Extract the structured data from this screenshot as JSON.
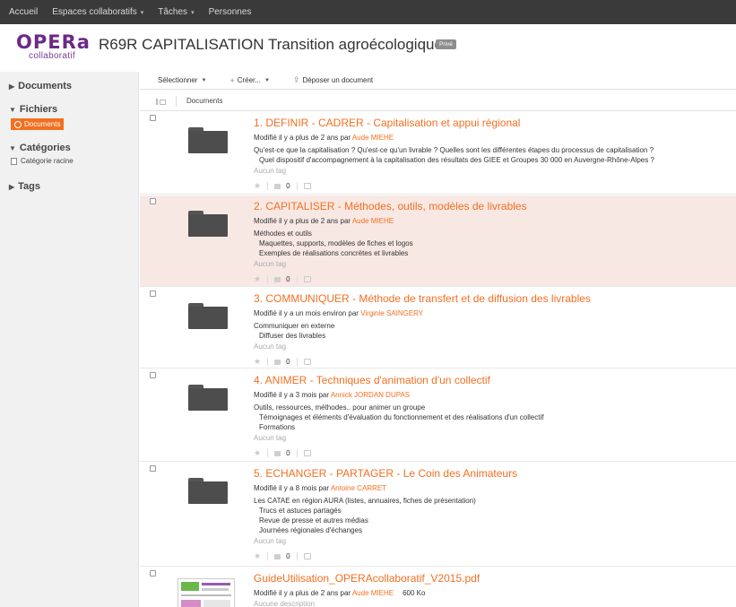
{
  "topnav": {
    "items": [
      {
        "label": "Accueil",
        "caret": ""
      },
      {
        "label": "Espaces collaboratifs",
        "caret": "▾"
      },
      {
        "label": "Tâches",
        "caret": "▾"
      },
      {
        "label": "Personnes",
        "caret": ""
      }
    ]
  },
  "header": {
    "logo_main": "OPERa",
    "logo_sub": "collaboratif",
    "title": "R69R CAPITALISATION Transition agroécologique",
    "badge": "Privé"
  },
  "sidebar": {
    "documents": "Documents",
    "fichiers": "Fichiers",
    "active_item": "Documents",
    "categories": "Catégories",
    "cat_root": "Catégorie racine",
    "tags": "Tags"
  },
  "toolbar": {
    "select_label": "Sélectionner",
    "create_label": "Créer...",
    "upload_label": "Déposer un document"
  },
  "columns": {
    "documents": "Documents"
  },
  "rows": [
    {
      "title": "1. DEFINIR - CADRER - Capitalisation et appui régional",
      "meta_prefix": "Modifié il y a plus de 2 ans par",
      "author": "Aude MIEHE",
      "desc": [
        "Qu'est-ce que la capitalisation ? Qu'est-ce qu'un livrable ? Quelles sont les différentes étapes du processus de capitalisation ?",
        "Quel dispositif d'accompagnement à la capitalisation des résultats des GIEE et Groupes 30 000 en Auvergne-Rhône-Alpes ?"
      ],
      "tags": "Aucun tag",
      "likes": "0"
    },
    {
      "title": "2. CAPITALISER - Méthodes, outils, modèles de livrables",
      "meta_prefix": "Modifié il y a plus de 2 ans par",
      "author": "Aude MIEHE",
      "desc": [
        "Méthodes et outils",
        "Maquettes, supports, modèles de fiches et logos",
        "Exemples de réalisations concrètes et livrables"
      ],
      "tags": "Aucun tag",
      "likes": "0"
    },
    {
      "title": "3. COMMUNIQUER - Méthode de transfert et de diffusion des livrables",
      "meta_prefix": "Modifié il y a un mois environ par",
      "author": "Virginie SAINGERY",
      "desc": [
        "Communiquer en externe",
        "Diffuser des livrables"
      ],
      "tags": "Aucun tag",
      "likes": "0"
    },
    {
      "title": "4. ANIMER - Techniques d'animation d'un collectif",
      "meta_prefix": "Modifié il y a 3 mois par",
      "author": "Annick JORDAN DUPAS",
      "desc": [
        "Outils, ressources, méthodes.. pour animer un groupe",
        "Témoignages et éléments d'évaluation du fonctionnement et des réalisations d'un collectif",
        "Formations"
      ],
      "tags": "Aucun tag",
      "likes": "0"
    },
    {
      "title": "5. ECHANGER - PARTAGER - Le Coin des Animateurs",
      "meta_prefix": "Modifié il y a 8 mois par",
      "author": "Antoine CARRET",
      "desc": [
        "Les CATAE en région AURA (listes, annuaires, fiches de présentation)",
        "Trucs et astuces partagés",
        "Revue de presse et autres médias",
        "Journées régionales d'échanges"
      ],
      "tags": "Aucun tag",
      "likes": "0"
    },
    {
      "title": "GuideUtilisation_OPERAcollaboratif_V2015.pdf",
      "meta_prefix": "Modifié il y a plus de 2 ans par",
      "author": "Aude MIEHE",
      "size": "600 Ko",
      "desc": [
        "Aucune description"
      ]
    }
  ]
}
